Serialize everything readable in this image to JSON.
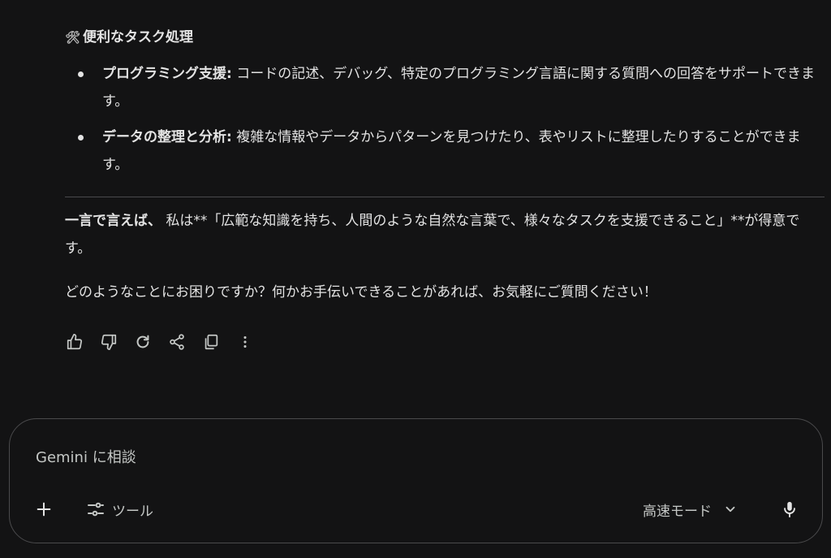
{
  "response": {
    "heading": {
      "emoji": "🛠",
      "text": "便利なタスク処理"
    },
    "bullets": [
      {
        "bold": "プログラミング支援:",
        "text": " コードの記述、デバッグ、特定のプログラミング言語に関する質問への回答をサポートできます。"
      },
      {
        "bold": "データの整理と分析:",
        "text": " 複雑な情報やデータからパターンを見つけたり、表やリストに整理したりすることができます。"
      }
    ],
    "summary": {
      "bold": "一言で言えば、",
      "text": " 私は**「広範な知識を持ち、人間のような自然な言葉で、様々なタスクを支援できること」**が得意です。"
    },
    "closing": "どのようなことにお困りですか？何かお手伝いできることがあれば、お気軽にご質問ください！"
  },
  "actions": [
    {
      "name": "thumbs-up-icon"
    },
    {
      "name": "thumbs-down-icon"
    },
    {
      "name": "regenerate-icon"
    },
    {
      "name": "share-icon"
    },
    {
      "name": "copy-icon"
    },
    {
      "name": "more-vert-icon"
    }
  ],
  "composer": {
    "placeholder": "Gemini に相談",
    "tools_label": "ツール",
    "mode_label": "高速モード"
  },
  "colors": {
    "background": "#131314",
    "text": "#e3e3e3",
    "muted_text": "#c4c7c5",
    "border": "#4a4a4c"
  }
}
